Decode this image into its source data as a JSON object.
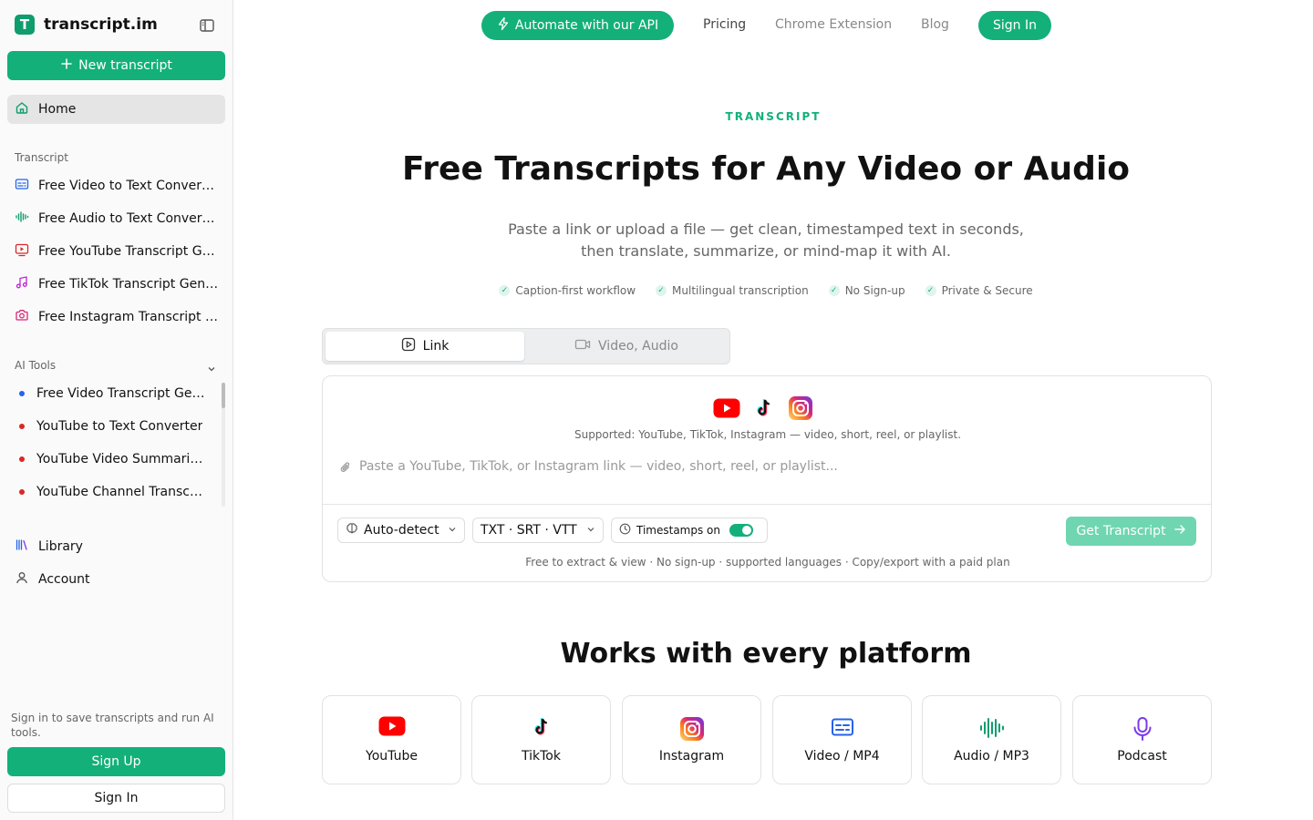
{
  "sidebar": {
    "brand_logo_letter": "T",
    "brand_name": "transcript.im",
    "new_transcript": "New transcript",
    "home": "Home",
    "transcript_section": "Transcript",
    "transcript_items": [
      {
        "label": "Free Video to Text Converter",
        "icon": "subtitles-icon",
        "color": "#2563eb"
      },
      {
        "label": "Free Audio to Text Converter",
        "icon": "waveform-icon",
        "color": "#0f9d6e"
      },
      {
        "label": "Free YouTube Transcript Generator",
        "icon": "youtube-icon",
        "color": "#dc2626"
      },
      {
        "label": "Free TikTok Transcript Generator",
        "icon": "music-note-icon",
        "color": "#c026d3"
      },
      {
        "label": "Free Instagram Transcript Generator",
        "icon": "camera-icon",
        "color": "#db2777"
      }
    ],
    "ai_tools_section": "AI Tools",
    "ai_tools_items": [
      {
        "label": "Free Video Transcript Generator",
        "dot_color": "#2563eb"
      },
      {
        "label": "YouTube to Text Converter",
        "dot_color": "#dc2626"
      },
      {
        "label": "YouTube Video Summarizer",
        "dot_color": "#dc2626"
      },
      {
        "label": "YouTube Channel Transcript",
        "dot_color": "#dc2626"
      }
    ],
    "library": "Library",
    "account": "Account",
    "signin_note": "Sign in to save transcripts and run AI tools.",
    "sign_up": "Sign Up",
    "sign_in": "Sign In"
  },
  "topnav": {
    "api_button": "Automate with our API",
    "pricing": "Pricing",
    "chrome_extension": "Chrome Extension",
    "blog": "Blog",
    "sign_in": "Sign In"
  },
  "hero": {
    "eyebrow": "TRANSCRIPT",
    "title": "Free Transcripts for Any Video or Audio",
    "subtitle": "Paste a link or upload a file — get clean, timestamped text in seconds, then translate, summarize, or mind-map it with AI.",
    "badges": [
      "Caption-first workflow",
      "Multilingual transcription",
      "No Sign-up",
      "Private & Secure"
    ]
  },
  "tabs": {
    "link": "Link",
    "video_audio": "Video, Audio"
  },
  "card": {
    "supported": "Supported: YouTube, TikTok, Instagram — video, short, reel, or playlist.",
    "input_value": "",
    "input_placeholder": "Paste a YouTube, TikTok, or Instagram link — video, short, reel, or playlist...",
    "language_select": "Auto-detect",
    "format_select": "TXT · SRT · VTT",
    "timestamps": "Timestamps on",
    "timestamps_enabled": true,
    "get_transcript": "Get Transcript",
    "footnote": "Free to extract & view · No sign-up · supported languages · Copy/export with a paid plan"
  },
  "platforms": {
    "title": "Works with every platform",
    "items": [
      {
        "label": "YouTube",
        "icon": "youtube-icon"
      },
      {
        "label": "TikTok",
        "icon": "tiktok-icon"
      },
      {
        "label": "Instagram",
        "icon": "instagram-icon"
      },
      {
        "label": "Video / MP4",
        "icon": "subtitles-icon"
      },
      {
        "label": "Audio / MP3",
        "icon": "waveform-icon"
      },
      {
        "label": "Podcast",
        "icon": "microphone-icon"
      }
    ]
  },
  "colors": {
    "accent": "#13b07a",
    "accent_disabled": "#6fd6b1",
    "youtube_red": "#ff0000",
    "instagram_pink": "#d62976",
    "video_blue": "#2563eb",
    "audio_green": "#0f9d6e",
    "podcast_purple": "#7c3aed"
  }
}
